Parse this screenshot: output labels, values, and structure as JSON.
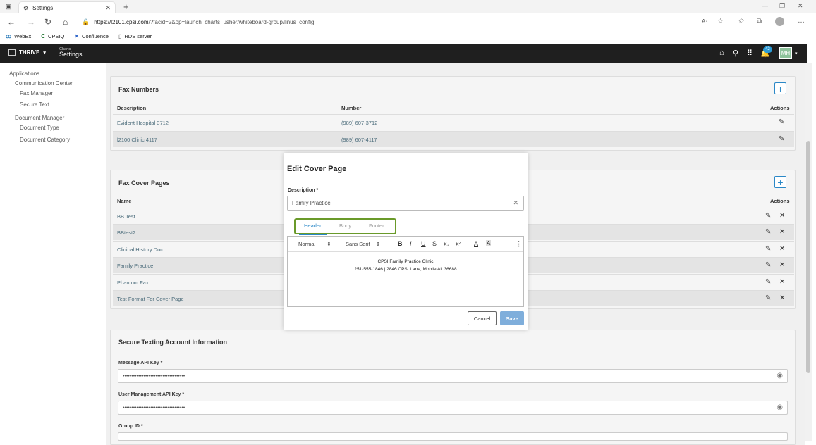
{
  "browser": {
    "tab_title": "Settings",
    "url_host": "https://l2101.cpsi.com",
    "url_path": "/?facid=2&op=launch_charts_usher/whiteboard-group/linus_config",
    "bookmarks": [
      {
        "icon": "webex-icon",
        "label": "WebEx"
      },
      {
        "icon": "cpsiq-icon",
        "label": "CPSIQ"
      },
      {
        "icon": "confluence-icon",
        "label": "Confluence"
      },
      {
        "icon": "page-icon",
        "label": "RDS server"
      }
    ]
  },
  "app": {
    "brand": "THRIVE",
    "crumb_small": "Charts",
    "crumb_big": "Settings",
    "notifications": "42",
    "avatar": "MH"
  },
  "leftnav": {
    "items": [
      "Applications",
      "Communication Center",
      "Fax Manager",
      "Secure Text",
      "Document Manager",
      "Document Type",
      "Document Category"
    ]
  },
  "fax_numbers": {
    "title": "Fax Numbers",
    "col_description": "Description",
    "col_number": "Number",
    "col_actions": "Actions",
    "rows": [
      {
        "description": "Evident Hospital 3712",
        "number": "(989) 607-3712"
      },
      {
        "description": "l2100 Clinic 4117",
        "number": "(989) 607-4117"
      }
    ]
  },
  "fax_cover": {
    "title": "Fax Cover Pages",
    "col_name": "Name",
    "col_actions": "Actions",
    "rows": [
      "BB Test",
      "BBtest2",
      "Clinical History Doc",
      "Family Practice",
      "Phantom Fax",
      "Test Format For Cover Page"
    ]
  },
  "secure_text": {
    "title": "Secure Texting Account Information",
    "message_label": "Message API Key *",
    "message_value": "••••••••••••••••••••••••••••••••••••",
    "user_label": "User Management API Key *",
    "user_value": "••••••••••••••••••••••••••••••••••••",
    "group_label": "Group ID *"
  },
  "modal": {
    "title": "Edit Cover Page",
    "desc_label": "Description *",
    "desc_value": "Family Practice",
    "tabs": [
      "Header",
      "Body",
      "Footer"
    ],
    "format": "Normal",
    "font": "Sans Serif",
    "line1": "CPSI Family Practice Clinic",
    "line2": "251-555-1846 | 2846 CPSI Lane, Mobile AL 36688",
    "cancel": "Cancel",
    "save": "Save"
  }
}
